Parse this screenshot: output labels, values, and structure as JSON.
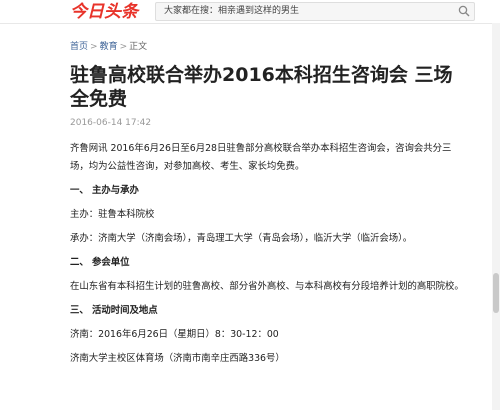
{
  "header": {
    "logo_text": "今日头条",
    "search_placeholder": "大家都在搜：相亲遇到这样的男生",
    "accent_color": "#e8332a",
    "search_icon": "search-icon"
  },
  "breadcrumb": [
    "首页",
    "教育",
    "正文"
  ],
  "article": {
    "title": "驻鲁高校联合举办2016本科招生咨询会 三场全免费",
    "date": "2016-06-14 17:42",
    "paragraphs": [
      "齐鲁网讯 2016年6月26日至6月28日驻鲁部分高校联合举办本科招生咨询会，咨询会共分三场，均为公益性咨询，对参加高校、考生、家长均免费。",
      "一、 主办与承办",
      "主办：驻鲁本科院校",
      "承办：济南大学（济南会场），青岛理工大学（青岛会场），临沂大学（临沂会场）。",
      "二、 参会单位",
      "在山东省有本科招生计划的驻鲁高校、部分省外高校、与本科高校有分段培养计划的高职院校。",
      "三、 活动时间及地点",
      "济南：2016年6月26日（星期日）8：30-12：00",
      "济南大学主校区体育场（济南市南辛庄西路336号）"
    ]
  }
}
